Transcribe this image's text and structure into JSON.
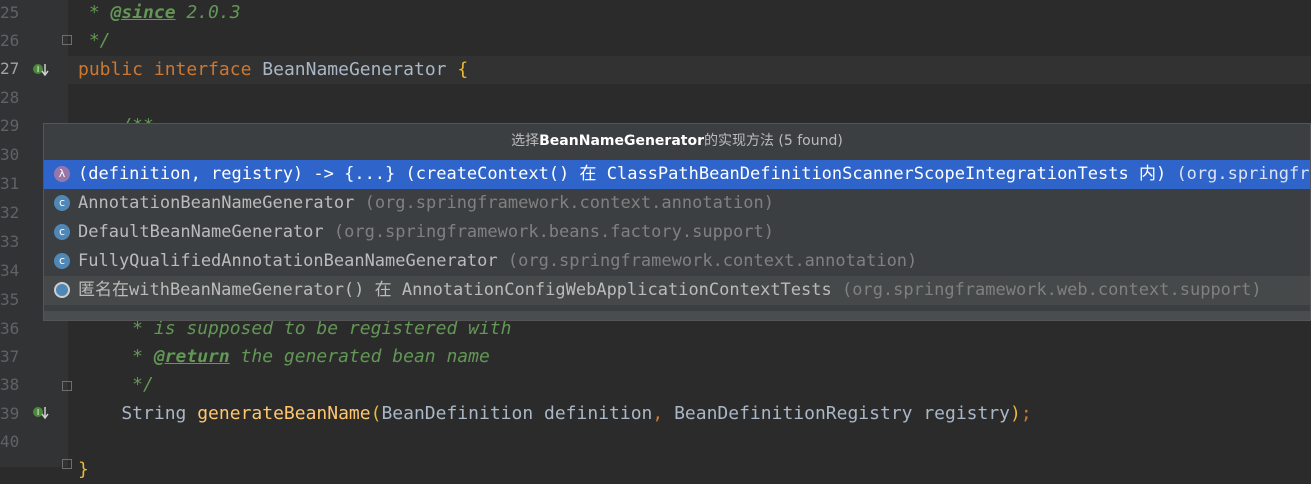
{
  "gutter": {
    "lines": [
      "25",
      "26",
      "27",
      "28",
      "29",
      "30",
      "31",
      "32",
      "33",
      "34",
      "35",
      "36",
      "37",
      "38",
      "39",
      "40"
    ]
  },
  "code": {
    "l25_star": " * ",
    "l25_tag": "@since",
    "l25_text": " 2.0.3",
    "l26": " */",
    "l27_kw1": "public",
    "l27_kw2": "interface",
    "l27_name": "BeanNameGenerator",
    "l27_brace": "{",
    "l29": "    /**",
    "l36": "     * is supposed to be registered with",
    "l37_star": "     * ",
    "l37_tag": "@return",
    "l37_text": " the generated bean name",
    "l38": "     */",
    "l39_type": "    String ",
    "l39_fn": "generateBeanName",
    "l39_p1": "(",
    "l39_args1": "BeanDefinition definition",
    "l39_comma": ", ",
    "l39_args2": "BeanDefinitionRegistry registry",
    "l39_p2": ")",
    "l39_semi": ";",
    "l41": "}"
  },
  "popup": {
    "header_prefix": "选择",
    "header_bold": "BeanNameGenerator",
    "header_suffix": "的实现方法 (5 found)",
    "items": [
      {
        "icon": "lambda-icon",
        "main": "(definition, registry) -> {...} (createContext() 在 ClassPathBeanDefinitionScannerScopeIntegrationTests 内)",
        "pkg": " (org.springframework.context.annotation)"
      },
      {
        "icon": "class-icon",
        "main": "AnnotationBeanNameGenerator",
        "pkg": " (org.springframework.context.annotation)"
      },
      {
        "icon": "class-icon",
        "main": "DefaultBeanNameGenerator",
        "pkg": " (org.springframework.beans.factory.support)"
      },
      {
        "icon": "class-icon",
        "main": "FullyQualifiedAnnotationBeanNameGenerator",
        "pkg": " (org.springframework.context.annotation)"
      },
      {
        "icon": "anonymous-class-icon",
        "main": "匿名在withBeanNameGenerator() 在 AnnotationConfigWebApplicationContextTests",
        "pkg": " (org.springframework.web.context.support)"
      }
    ]
  },
  "colors": {
    "background": "#2b2b2b",
    "selection": "#2f65ca",
    "keyword": "#cc7832",
    "comment": "#629755"
  }
}
